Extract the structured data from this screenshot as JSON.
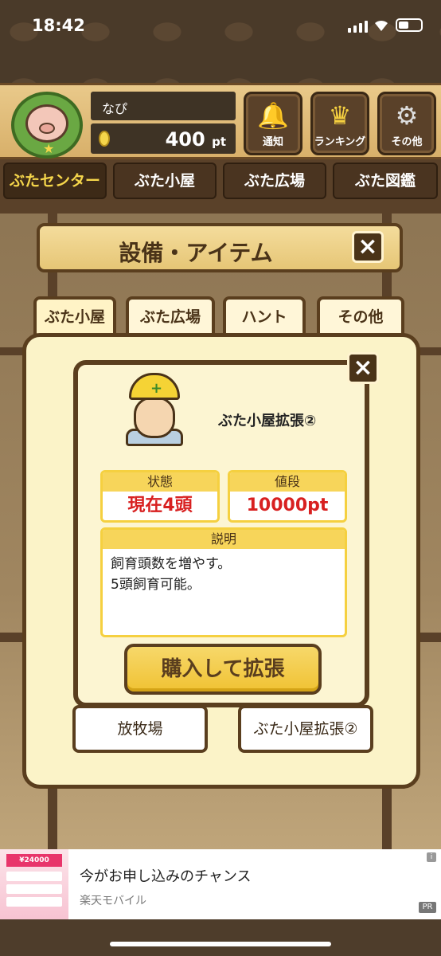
{
  "status": {
    "time": "18:42"
  },
  "header": {
    "name": "なぴ",
    "points_value": "400",
    "points_unit": "pt",
    "buttons": [
      {
        "label": "通知",
        "icon": "bell-icon"
      },
      {
        "label": "ランキング",
        "icon": "crown-icon"
      },
      {
        "label": "その他",
        "icon": "gear-icon"
      }
    ]
  },
  "nav": [
    "ぶたセンター",
    "ぶた小屋",
    "ぶた広場",
    "ぶた図鑑"
  ],
  "title": "設備・アイテム",
  "tabs": [
    "ぶた小屋",
    "ぶた広場",
    "ハント",
    "その他"
  ],
  "list_items": [
    "放牧場",
    "ぶた小屋拡張②"
  ],
  "dialog": {
    "item_name": "ぶた小屋拡張②",
    "status_label": "状態",
    "status_value": "現在4頭",
    "price_label": "値段",
    "price_value": "10000pt",
    "desc_label": "説明",
    "desc_line1": "飼育頭数を増やす。",
    "desc_line2": "5頭飼育可能。",
    "buy_label": "購入して拡張"
  },
  "ad": {
    "headline": "今がお申し込みのチャンス",
    "advertiser": "楽天モバイル",
    "pr": "PR",
    "info": "i",
    "thumb_price": "¥24000"
  },
  "colors": {
    "wood": "#5a3e1e",
    "panel": "#fbf3c8",
    "accent_yellow": "#f5d040",
    "price_red": "#d82020"
  }
}
